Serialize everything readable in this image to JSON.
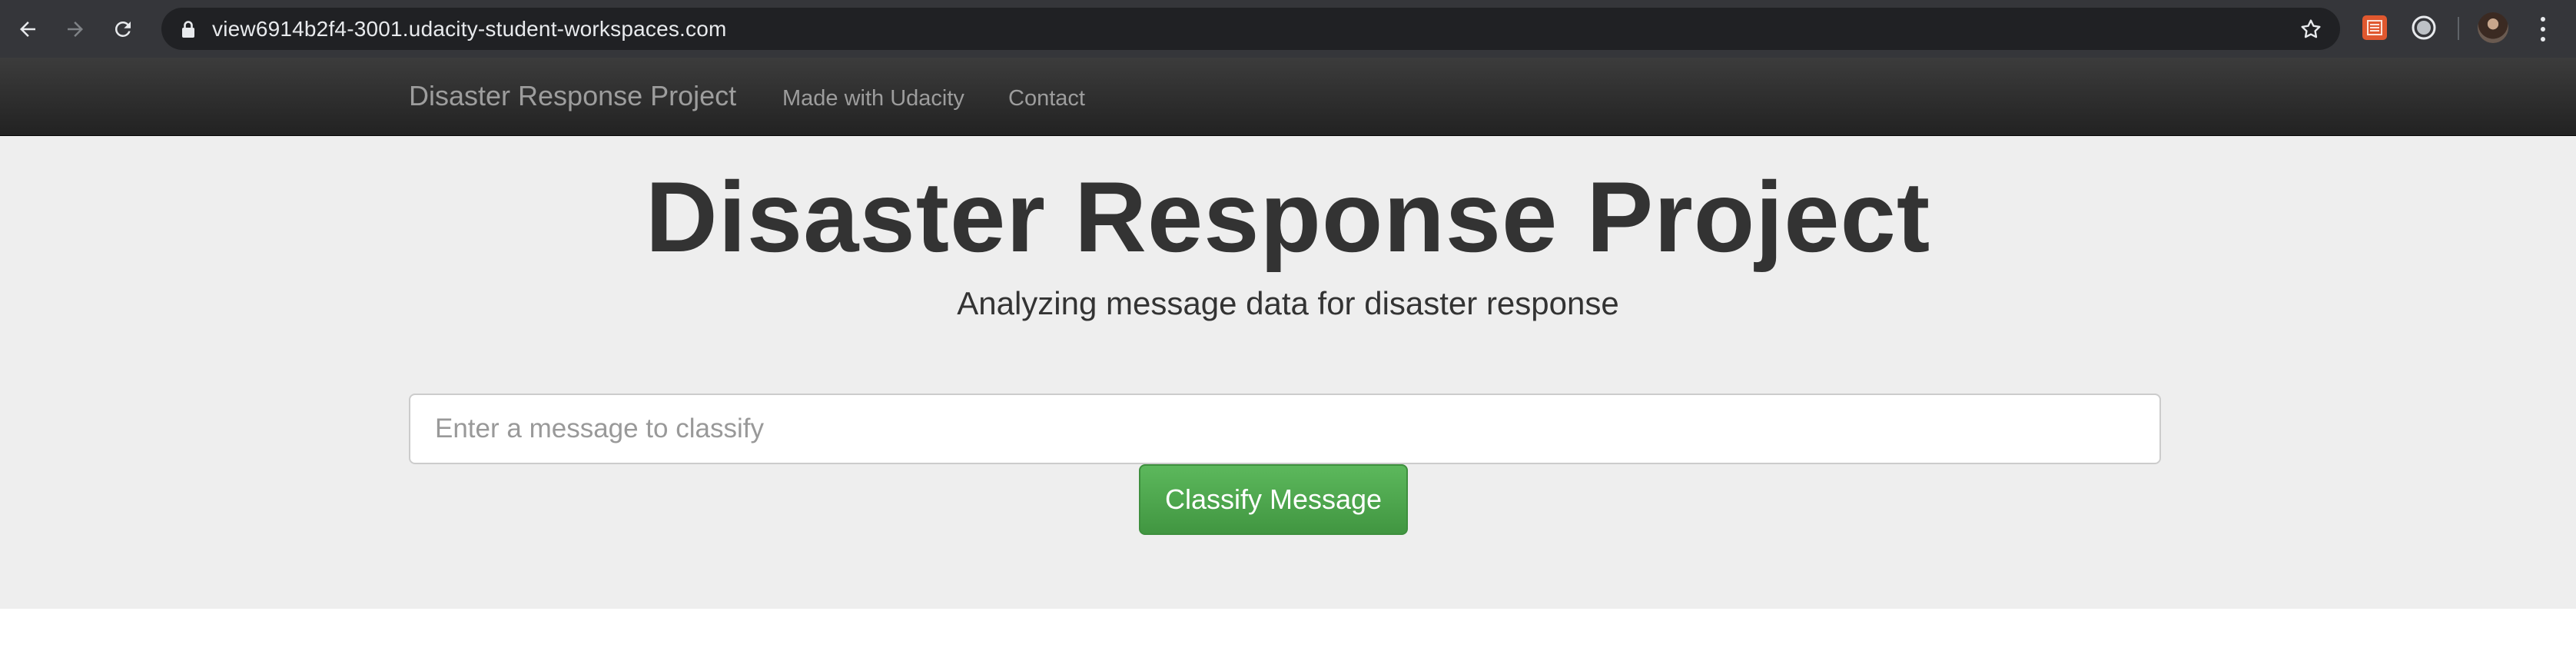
{
  "browser": {
    "url": "view6914b2f4-3001.udacity-student-workspaces.com",
    "icons": {
      "back": "back-arrow-icon",
      "forward": "forward-arrow-icon",
      "reload": "reload-icon",
      "lock": "lock-icon",
      "bookmark": "star-icon",
      "menu": "kebab-menu-icon"
    },
    "colors": {
      "toolbar": "#35363a",
      "omnibox": "#202124",
      "text": "#e8eaed"
    }
  },
  "navbar": {
    "brand": "Disaster Response Project",
    "links": [
      {
        "label": "Made with Udacity"
      },
      {
        "label": "Contact"
      }
    ],
    "colors": {
      "background": "#222222",
      "text": "#9d9d9d"
    }
  },
  "jumbotron": {
    "title": "Disaster Response Project",
    "subtitle": "Analyzing message data for disaster response",
    "input": {
      "placeholder": "Enter a message to classify",
      "value": ""
    },
    "button_label": "Classify Message",
    "colors": {
      "background": "#eeeeee",
      "button": "#5cb85c",
      "text": "#333333"
    }
  }
}
